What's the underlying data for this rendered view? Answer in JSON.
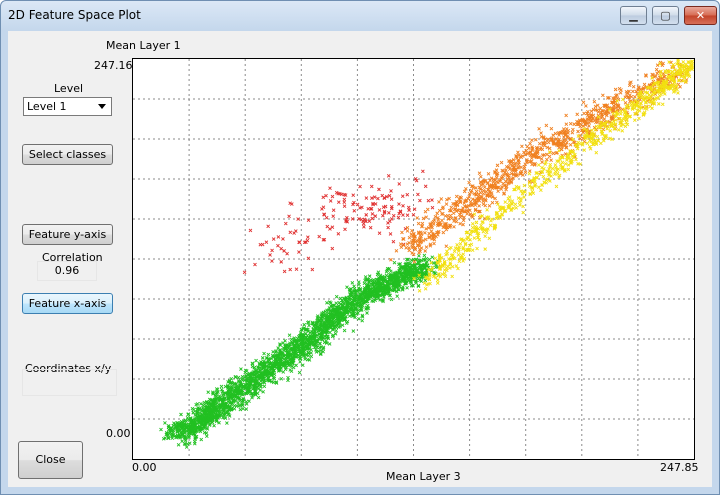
{
  "window": {
    "title": "2D Feature Space Plot",
    "minimize_glyph": "▁",
    "maximize_glyph": "▢",
    "close_glyph": "✕"
  },
  "controls": {
    "level_caption": "Level",
    "level_value": "Level 1",
    "select_classes_label": "Select classes",
    "feature_y_label": "Feature y-axis",
    "correlation_caption": "Correlation",
    "correlation_value": "0.96",
    "feature_x_label": "Feature x-axis",
    "coordinates_caption": "Coordinates x/y",
    "coordinates_value": "",
    "close_label": "Close"
  },
  "chart_data": {
    "type": "scatter",
    "title": "",
    "xlabel": "Mean Layer 3",
    "ylabel": "Mean Layer 1",
    "xlim": [
      0.0,
      247.85
    ],
    "ylim": [
      0.0,
      247.16
    ],
    "x_min_label": "0.00",
    "x_max_label": "247.85",
    "y_min_label": "0.00",
    "y_max_label": "247.16",
    "grid": true,
    "grid_lines_x": 10,
    "grid_lines_y": 10,
    "series": [
      {
        "color": "#22c022",
        "marker": "x",
        "x_range": [
          2,
          135
        ],
        "y_range": [
          5,
          128
        ],
        "description_points": [
          [
            20,
            15
          ],
          [
            45,
            40
          ],
          [
            75,
            70
          ],
          [
            100,
            100
          ],
          [
            130,
            120
          ]
        ]
      },
      {
        "color": "#e03030",
        "marker": "x",
        "x_range": [
          40,
          140
        ],
        "y_range": [
          75,
          185
        ],
        "description_points": [
          [
            60,
            120
          ],
          [
            90,
            160
          ],
          [
            110,
            150
          ],
          [
            120,
            165
          ]
        ]
      },
      {
        "color": "#f08020",
        "marker": "x",
        "x_range": [
          100,
          245
        ],
        "y_range": [
          110,
          245
        ],
        "description_points": [
          [
            120,
            130
          ],
          [
            150,
            160
          ],
          [
            180,
            190
          ],
          [
            210,
            215
          ],
          [
            240,
            240
          ]
        ]
      },
      {
        "color": "#f2e010",
        "marker": "x",
        "x_range": [
          110,
          247
        ],
        "y_range": [
          100,
          247
        ],
        "description_points": [
          [
            130,
            110
          ],
          [
            160,
            150
          ],
          [
            200,
            195
          ],
          [
            230,
            225
          ],
          [
            246,
            245
          ]
        ]
      }
    ]
  }
}
